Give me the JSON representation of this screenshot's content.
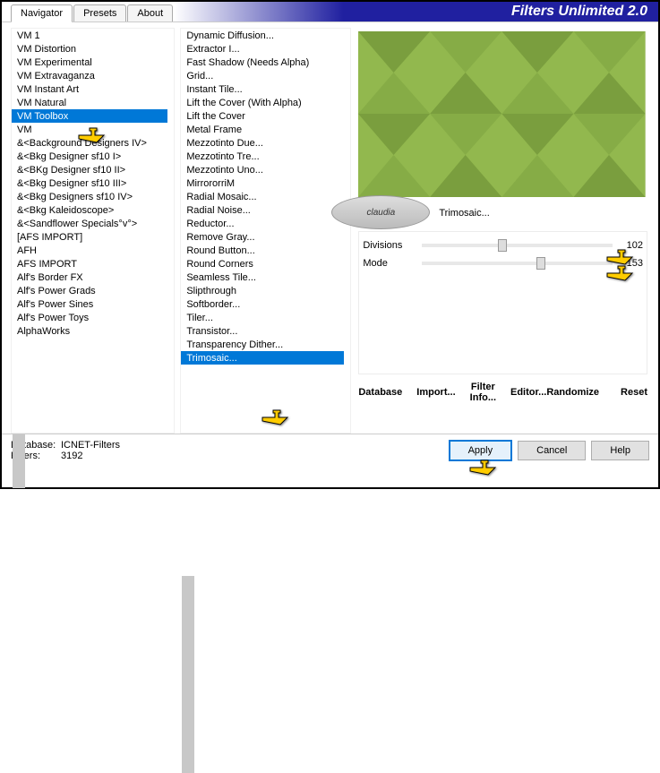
{
  "title": "Filters Unlimited 2.0",
  "tabs": [
    {
      "label": "Navigator",
      "active": true
    },
    {
      "label": "Presets",
      "active": false
    },
    {
      "label": "About",
      "active": false
    }
  ],
  "categories": [
    "VM 1",
    "VM Distortion",
    "VM Experimental",
    "VM Extravaganza",
    "VM Instant Art",
    "VM Natural",
    "VM Toolbox",
    "VM",
    "&<Background Designers IV>",
    "&<Bkg Designer sf10 I>",
    "&<BKg Designer sf10 II>",
    "&<Bkg Designer sf10 III>",
    "&<Bkg Designers sf10 IV>",
    "&<Bkg Kaleidoscope>",
    "&<Sandflower Specials°v°>",
    "[AFS IMPORT]",
    "AFH",
    "AFS IMPORT",
    "Alf's Border FX",
    "Alf's Power Grads",
    "Alf's Power Sines",
    "Alf's Power Toys",
    "AlphaWorks"
  ],
  "selected_category": "VM Toolbox",
  "filters": [
    "Dynamic Diffusion...",
    "Extractor I...",
    "Fast Shadow (Needs Alpha)",
    "Grid...",
    "Instant Tile...",
    "Lift the Cover (With Alpha)",
    "Lift the Cover",
    "Metal Frame",
    "Mezzotinto Due...",
    "Mezzotinto Tre...",
    "Mezzotinto Uno...",
    "MirrororriM",
    "Radial Mosaic...",
    "Radial Noise...",
    "Reductor...",
    "Remove Gray...",
    "Round Button...",
    "Round Corners",
    "Seamless Tile...",
    "Slipthrough",
    "Softborder...",
    "Tiler...",
    "Transistor...",
    "Transparency Dither...",
    "Trimosaic..."
  ],
  "selected_filter": "Trimosaic...",
  "current_filter_display": "Trimosaic...",
  "watermark_text": "claudia",
  "params": [
    {
      "label": "Divisions",
      "value": 102,
      "pos": 40
    },
    {
      "label": "Mode",
      "value": 153,
      "pos": 60
    }
  ],
  "link_buttons_left": [
    "Database",
    "Import...",
    "Filter Info...",
    "Editor..."
  ],
  "link_buttons_right": [
    "Randomize",
    "Reset"
  ],
  "footer": {
    "db_label": "Database:",
    "db_value": "ICNET-Filters",
    "filters_label": "Filters:",
    "filters_value": "3192"
  },
  "footer_buttons": {
    "apply": "Apply",
    "cancel": "Cancel",
    "help": "Help"
  }
}
